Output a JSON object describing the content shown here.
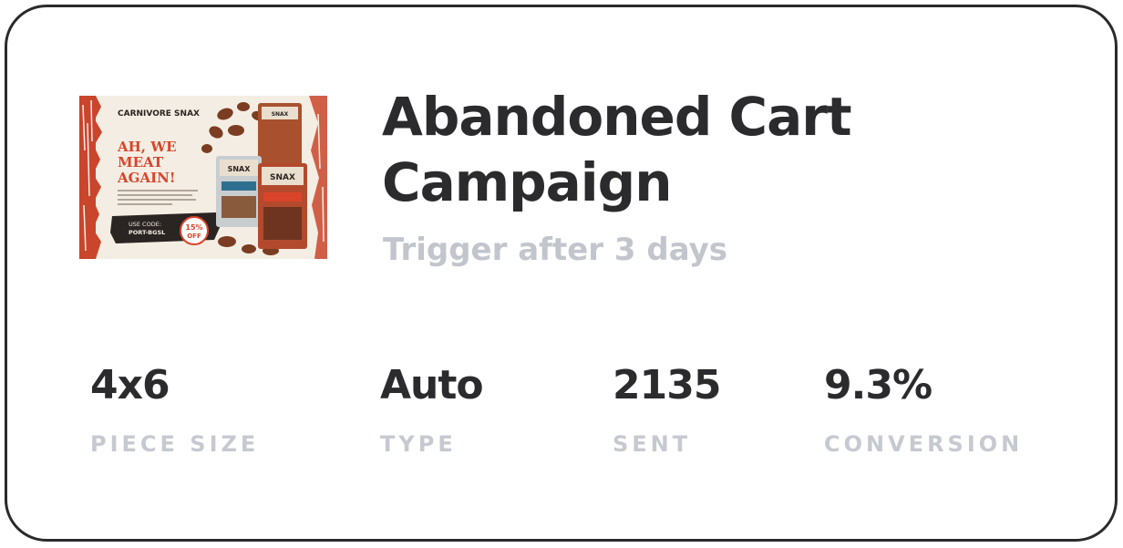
{
  "campaign": {
    "title": "Abandoned Cart Campaign",
    "subtitle": "Trigger after 3 days",
    "thumbnail": {
      "brand": "CARNIVORE SNAX",
      "headline_1": "AH, WE",
      "headline_2": "MEAT",
      "headline_3": "AGAIN!",
      "code_line_1": "USE CODE:",
      "code_line_2": "PORT-BGSL",
      "badge_percent": "15%",
      "badge_word": "OFF",
      "accent_color": "#d9442b",
      "dark_color": "#2a2422"
    }
  },
  "stats": [
    {
      "value": "4x6",
      "label": "PIECE SIZE"
    },
    {
      "value": "Auto",
      "label": "TYPE"
    },
    {
      "value": "2135",
      "label": "SENT"
    },
    {
      "value": "9.3%",
      "label": "CONVERSION"
    }
  ]
}
